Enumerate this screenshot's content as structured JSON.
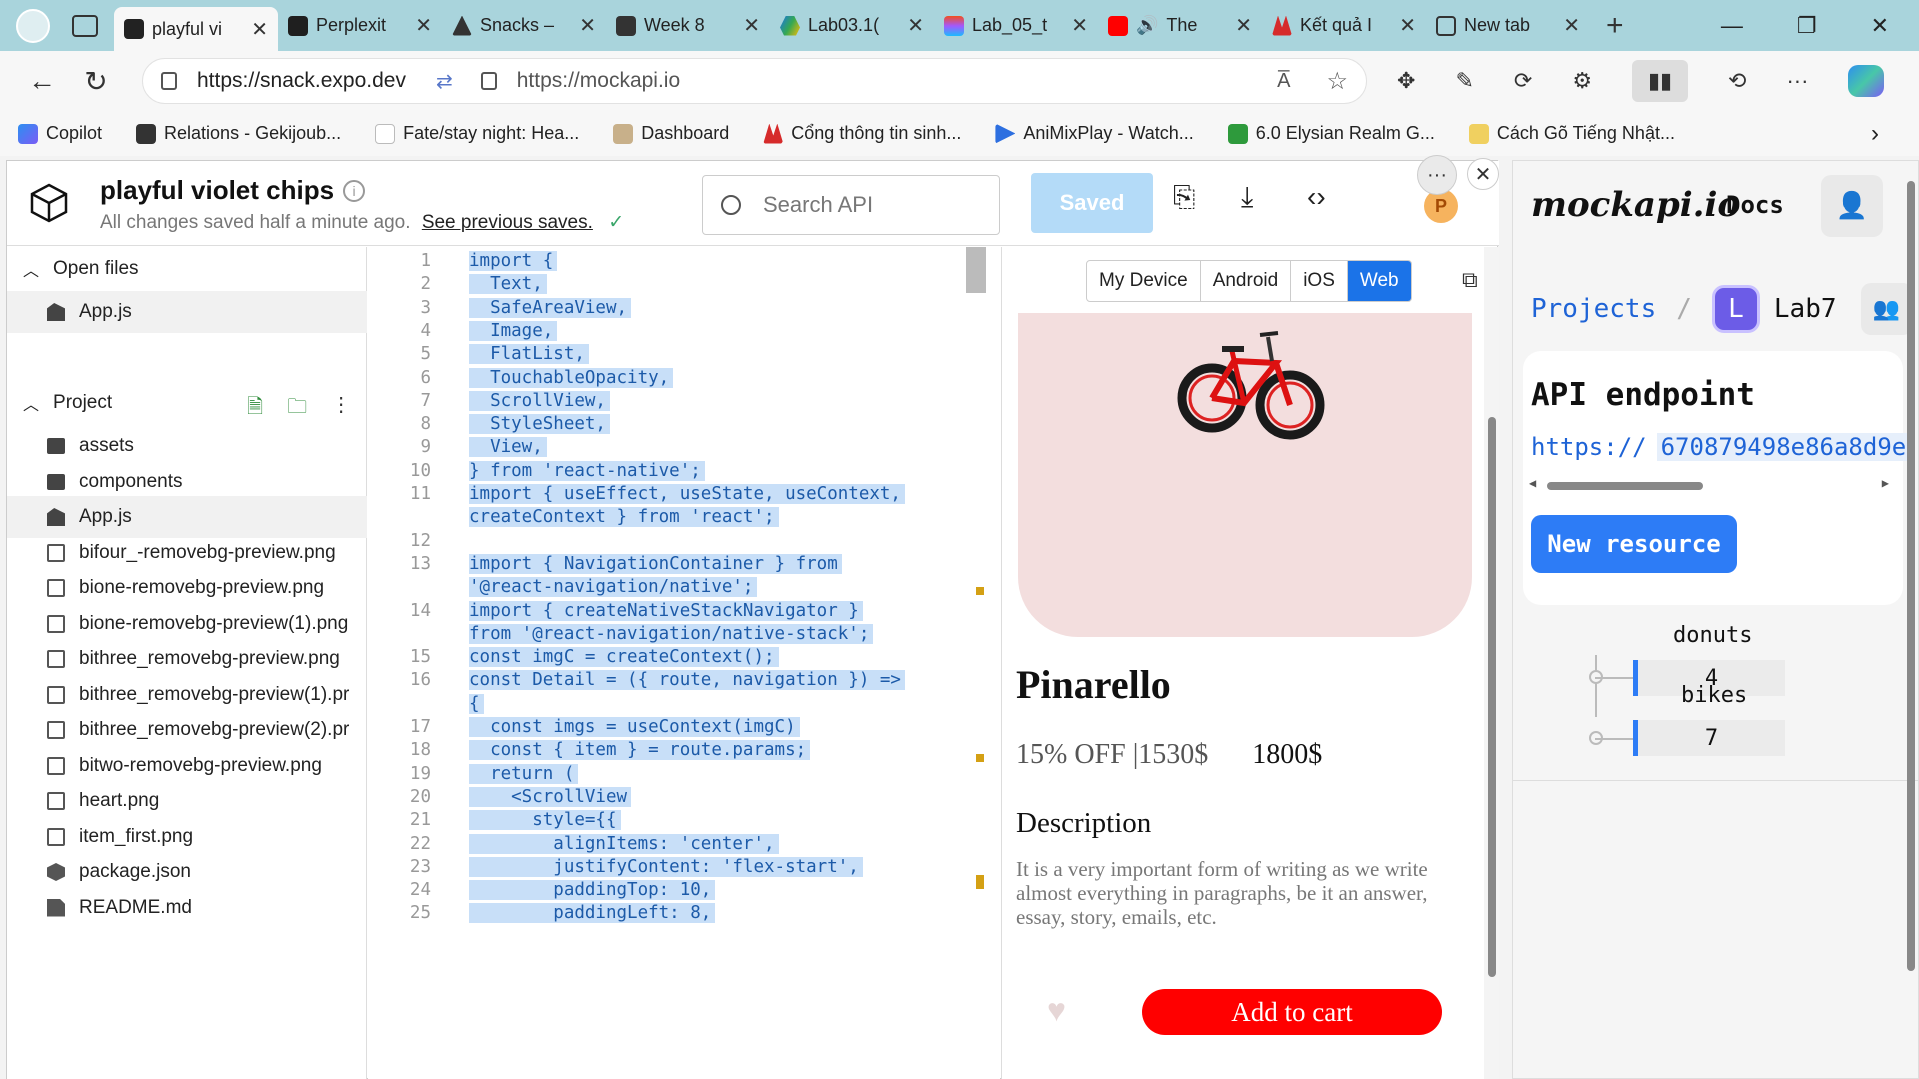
{
  "browser": {
    "tabs": [
      {
        "title": "playful vi",
        "active": true
      },
      {
        "title": "Perplexit"
      },
      {
        "title": "Snacks –"
      },
      {
        "title": "Week 8"
      },
      {
        "title": "Lab03.1("
      },
      {
        "title": "Lab_05_t"
      },
      {
        "title": "The"
      },
      {
        "title": "Kết quả I"
      },
      {
        "title": "New tab"
      }
    ],
    "address": "https://snack.expo.dev",
    "address_secondary": "https://mockapi.io",
    "read_aloud_label": "A̅",
    "bookmarks": [
      "Copilot",
      "Relations - Gekijoub...",
      "Fate/stay night: Hea...",
      "Dashboard",
      "Cổng thông tin sinh...",
      "AniMixPlay - Watch...",
      "6.0 Elysian Realm G...",
      "Cách Gõ Tiếng Nhật..."
    ]
  },
  "snack": {
    "project_title": "playful violet chips",
    "save_status": "All changes saved half a minute ago.",
    "previous_saves_link": "See previous saves.",
    "search_placeholder": "Search API",
    "saved_label": "Saved",
    "avatar_initial": "P",
    "sidebar": {
      "open_files_label": "Open files",
      "open_files": [
        "App.js"
      ],
      "project_label": "Project",
      "files": [
        {
          "name": "assets",
          "type": "folder"
        },
        {
          "name": "components",
          "type": "folder"
        },
        {
          "name": "App.js",
          "type": "js"
        },
        {
          "name": "bifour_-removebg-preview.png",
          "type": "img"
        },
        {
          "name": "bione-removebg-preview.png",
          "type": "img"
        },
        {
          "name": "bione-removebg-preview(1).png",
          "type": "img"
        },
        {
          "name": "bithree_removebg-preview.png",
          "type": "img"
        },
        {
          "name": "bithree_removebg-preview(1).pr",
          "type": "img"
        },
        {
          "name": "bithree_removebg-preview(2).pr",
          "type": "img"
        },
        {
          "name": "bitwo-removebg-preview.png",
          "type": "img"
        },
        {
          "name": "heart.png",
          "type": "img"
        },
        {
          "name": "item_first.png",
          "type": "img"
        },
        {
          "name": "package.json",
          "type": "pkg"
        },
        {
          "name": "README.md",
          "type": "doc"
        }
      ]
    },
    "code": {
      "line_numbers": [
        "1",
        "2",
        "3",
        "4",
        "5",
        "6",
        "7",
        "8",
        "9",
        "10",
        "11",
        "",
        "12",
        "13",
        "",
        "14",
        "",
        "15",
        "16",
        "",
        "17",
        "18",
        "19",
        "20",
        "21",
        "22",
        "23",
        "24",
        "25"
      ],
      "lines": [
        "import {",
        "  Text,",
        "  SafeAreaView,",
        "  Image,",
        "  FlatList,",
        "  TouchableOpacity,",
        "  ScrollView,",
        "  StyleSheet,",
        "  View,",
        "} from 'react-native';",
        "import { useEffect, useState, useContext,",
        "createContext } from 'react';",
        "",
        "import { NavigationContainer } from",
        "'@react-navigation/native';",
        "import { createNativeStackNavigator }",
        "from '@react-navigation/native-stack';",
        "const imgC = createContext();",
        "const Detail = ({ route, navigation }) =>",
        "{",
        "  const imgs = useContext(imgC)",
        "  const { item } = route.params;",
        "  return (",
        "    <ScrollView",
        "      style={{",
        "        alignItems: 'center',",
        "        justifyContent: 'flex-start',",
        "        paddingTop: 10,",
        "        paddingLeft: 8,"
      ]
    },
    "preview": {
      "device_tabs": [
        "My Device",
        "Android",
        "iOS",
        "Web"
      ],
      "active_device": "Web",
      "product_name": "Pinarello",
      "discount_price": "15% OFF |1530$",
      "original_price": "1800$",
      "description_heading": "Description",
      "description": "It is a very important form of writing as we write almost everything in paragraphs, be it an answer, essay, story, emails, etc.",
      "cart_button": "Add to cart"
    }
  },
  "mockapi": {
    "logo": "mockapi.io",
    "docs_label": "Docs",
    "breadcrumb_projects": "Projects",
    "breadcrumb_sep": "/",
    "project_badge": "L",
    "project_name": "Lab7",
    "api_title": "API endpoint",
    "api_scheme": "https://",
    "api_id": "670879498e86a8d9e",
    "new_resource_label": "New resource",
    "resources": [
      {
        "name": "donuts",
        "count": "4"
      },
      {
        "name": "bikes",
        "count": "7"
      }
    ]
  },
  "colors": {
    "tabbar_bg": "#a9d4dc",
    "saved_button": "#b4dbf8",
    "selection": "#c8dff8",
    "web_tab_active": "#1b73e8",
    "cart_button": "#ff0000",
    "mockapi_blue": "#2d7cf6",
    "project_badge": "#6c5ce7"
  }
}
